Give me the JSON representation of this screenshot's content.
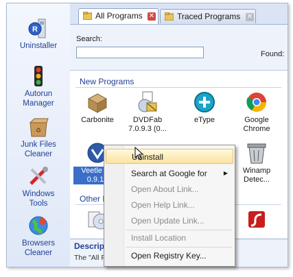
{
  "sidebar": {
    "items": [
      {
        "label": "Uninstaller",
        "icon": "uninstaller-icon"
      },
      {
        "label": "Autorun\nManager",
        "icon": "traffic-light-icon"
      },
      {
        "label": "Junk Files\nCleaner",
        "icon": "junk-box-icon"
      },
      {
        "label": "Windows\nTools",
        "icon": "tools-icon"
      },
      {
        "label": "Browsers\nCleaner",
        "icon": "browser-globe-icon"
      }
    ]
  },
  "tabs": [
    {
      "label": "All Programs",
      "active": true
    },
    {
      "label": "Traced Programs",
      "active": false
    }
  ],
  "search": {
    "label": "Search:",
    "value": "",
    "found_label": "Found:"
  },
  "groups": {
    "new_programs": "New Programs",
    "other_programs": "Other Pr"
  },
  "programs_row1": [
    {
      "label": "Carbonite",
      "icon": "carbonite-icon"
    },
    {
      "label": "DVDFab\n7.0.9.3 (0...",
      "icon": "installer-icon"
    },
    {
      "label": "eType",
      "icon": "etype-icon"
    },
    {
      "label": "Google\nChrome",
      "icon": "chrome-icon"
    }
  ],
  "programs_row2": [
    {
      "label": "Veetle TV\n0.9.17",
      "icon": "veetle-icon",
      "selected": true
    },
    {
      "label": "Winamp\nDetec...",
      "icon": "winamp-icon"
    }
  ],
  "context_menu": {
    "items": [
      {
        "label": "Uninstall",
        "highlighted": true,
        "disabled": false
      },
      {
        "label": "Search at Google for",
        "submenu": true
      },
      {
        "label": "Open About Link...",
        "disabled": true
      },
      {
        "label": "Open Help Link...",
        "disabled": true
      },
      {
        "label": "Open Update Link...",
        "disabled": true
      },
      {
        "label": "Install Location",
        "disabled": true
      },
      {
        "label": "Open Registry Key...",
        "disabled": false
      }
    ]
  },
  "description": {
    "title": "Descriptio",
    "text": "The \"All Pro                                           shows all of th"
  },
  "colors": {
    "accent": "#1f3f93",
    "selection": "#3a6ec8",
    "menu_highlight": "#fbe3a2"
  }
}
